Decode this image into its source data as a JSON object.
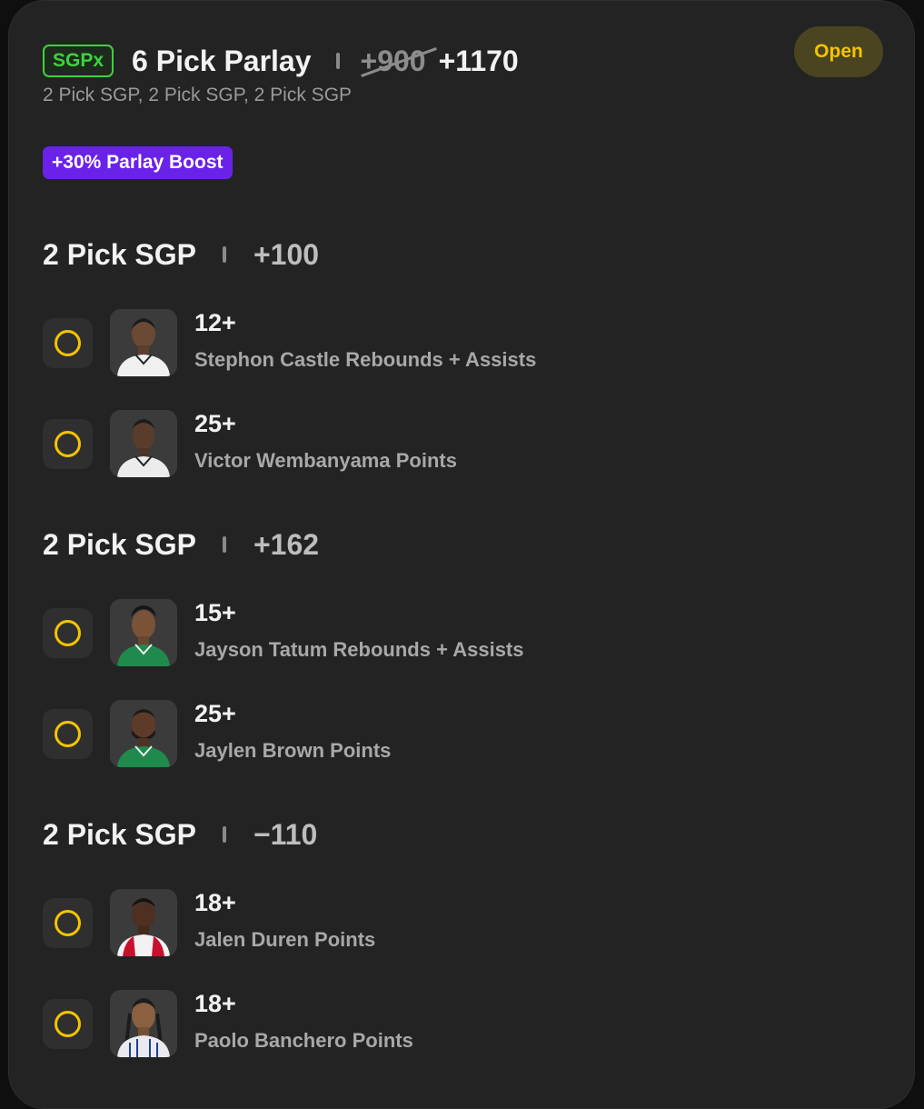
{
  "header": {
    "badge": "SGPx",
    "title": "6 Pick Parlay",
    "old_odds": "+900",
    "new_odds": "+1170",
    "subtitle": "2 Pick SGP, 2 Pick SGP, 2 Pick SGP",
    "status": "Open"
  },
  "boost": {
    "label": "+30% Parlay Boost"
  },
  "groups": [
    {
      "title": "2 Pick SGP",
      "odds": "+100",
      "legs": [
        {
          "line": "12+",
          "market": "Stephon Castle Rebounds + Assists",
          "jersey": "white"
        },
        {
          "line": "25+",
          "market": "Victor Wembanyama Points",
          "jersey": "white"
        }
      ]
    },
    {
      "title": "2 Pick SGP",
      "odds": "+162",
      "legs": [
        {
          "line": "15+",
          "market": "Jayson Tatum Rebounds + Assists",
          "jersey": "green"
        },
        {
          "line": "25+",
          "market": "Jaylen Brown Points",
          "jersey": "green"
        }
      ]
    },
    {
      "title": "2 Pick SGP",
      "odds": "−110",
      "legs": [
        {
          "line": "18+",
          "market": "Jalen Duren Points",
          "jersey": "white"
        },
        {
          "line": "18+",
          "market": "Paolo Banchero Points",
          "jersey": "white"
        }
      ]
    }
  ],
  "colors": {
    "accent_yellow": "#f5c400",
    "boost_purple": "#6a22e8",
    "sgpx_green": "#3bd43b",
    "card_bg": "#232323"
  }
}
